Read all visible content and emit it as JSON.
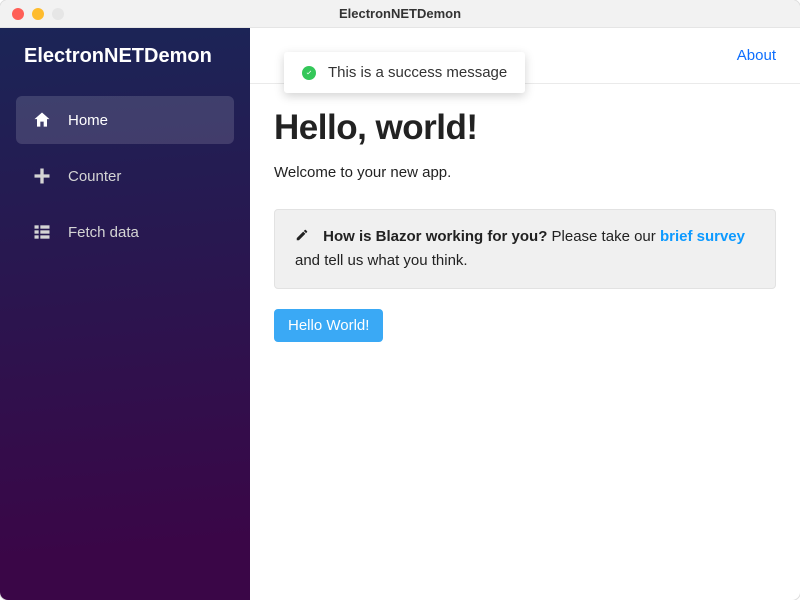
{
  "window": {
    "title": "ElectronNETDemon"
  },
  "sidebar": {
    "brand": "ElectronNETDemon",
    "items": [
      {
        "label": "Home"
      },
      {
        "label": "Counter"
      },
      {
        "label": "Fetch data"
      }
    ]
  },
  "topbar": {
    "about": "About"
  },
  "toast": {
    "message": "This is a success message"
  },
  "page": {
    "headline": "Hello, world!",
    "welcome": "Welcome to your new app."
  },
  "survey": {
    "question": "How is Blazor working for you?",
    "prompt_before": " Please take our ",
    "link": "brief survey",
    "prompt_after": " and tell us what you think."
  },
  "button": {
    "hello": "Hello World!"
  }
}
